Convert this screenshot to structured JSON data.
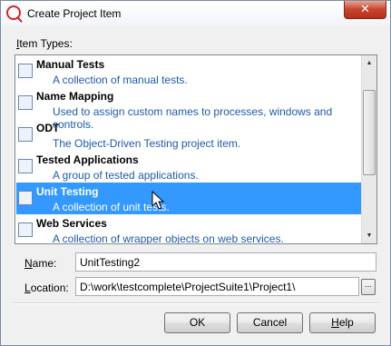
{
  "window": {
    "title": "Create Project Item",
    "close_label": "✕"
  },
  "item_types": {
    "label_underlined": "I",
    "label_rest": "tem Types:",
    "items": [
      {
        "name": "Manual Tests",
        "description": "A collection of manual tests.",
        "icon": "manual-tests-icon",
        "selected": false
      },
      {
        "name": "Name Mapping",
        "description": "Used to assign custom names to processes, windows and controls.",
        "icon": "name-mapping-icon",
        "selected": false
      },
      {
        "name": "ODT",
        "description": "The Object-Driven Testing project item.",
        "icon": "odt-icon",
        "selected": false
      },
      {
        "name": "Tested Applications",
        "description": "A group of tested applications.",
        "icon": "tested-applications-icon",
        "selected": false
      },
      {
        "name": "Unit Testing",
        "description": "A collection of unit tests.",
        "icon": "unit-testing-icon",
        "selected": true
      },
      {
        "name": "Web Services",
        "description": "A collection of wrapper objects on web services.",
        "icon": "web-services-icon",
        "selected": false
      }
    ]
  },
  "form": {
    "name_label_underlined": "N",
    "name_label_rest": "ame:",
    "name_value": "UnitTesting2",
    "location_label_underlined": "L",
    "location_label_rest": "ocation:",
    "location_value": "D:\\work\\testcomplete\\ProjectSuite1\\Project1\\",
    "browse_label": "..."
  },
  "buttons": {
    "ok": "OK",
    "cancel": "Cancel",
    "help_underlined": "H",
    "help_rest": "elp"
  },
  "colors": {
    "selection": "#3399ff",
    "description_text": "#1f5aa8",
    "close_button": "#c7432b"
  }
}
